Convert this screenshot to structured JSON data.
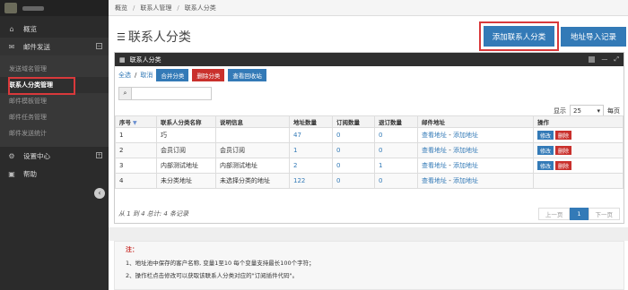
{
  "sidebar": {
    "items": [
      {
        "label": "概览",
        "icon": "home-icon"
      },
      {
        "label": "邮件发送",
        "icon": "mail-icon"
      },
      {
        "label": "设置中心",
        "icon": "gear-icon"
      },
      {
        "label": "帮助",
        "icon": "help-icon"
      }
    ],
    "sub_items": [
      {
        "label": "发送域名管理"
      },
      {
        "label": "联系人分类管理"
      },
      {
        "label": "邮件模板管理"
      },
      {
        "label": "邮件任务管理"
      },
      {
        "label": "邮件发送统计"
      }
    ]
  },
  "breadcrumb": [
    "概览",
    "联系人管理",
    "联系人分类"
  ],
  "page": {
    "title": "联系人分类",
    "add_button": "添加联系人分类",
    "import_button": "地址导入记录"
  },
  "panel": {
    "title": "联系人分类",
    "select_all": "全选",
    "cancel": "取消",
    "merge": "合并分类",
    "delete": "删除分类",
    "recycle": "查看回收站",
    "search_value": "",
    "page_size_label": "显示",
    "page_size_value": "25",
    "page_size_suffix": "每页"
  },
  "table": {
    "headers": [
      "序号",
      "联系人分类名称",
      "说明信息",
      "地址数量",
      "订阅数量",
      "退订数量",
      "邮件地址",
      "操作"
    ],
    "rows": [
      {
        "no": "1",
        "name": "巧",
        "desc": "",
        "addr": "47",
        "sub": "0",
        "unsub": "0",
        "view": "查看地址",
        "add": "添加地址",
        "edit": "修改",
        "del": "删除"
      },
      {
        "no": "2",
        "name": "会员订阅",
        "desc": "会员订阅",
        "addr": "1",
        "sub": "0",
        "unsub": "0",
        "view": "查看地址",
        "add": "添加地址",
        "edit": "修改",
        "del": "删除"
      },
      {
        "no": "3",
        "name": "内部测试地址",
        "desc": "内部测试地址",
        "addr": "2",
        "sub": "0",
        "unsub": "1",
        "view": "查看地址",
        "add": "添加地址",
        "edit": "修改",
        "del": "删除"
      },
      {
        "no": "4",
        "name": "未分类地址",
        "desc": "未选择分类的地址",
        "addr": "122",
        "sub": "0",
        "unsub": "0",
        "view": "查看地址",
        "add": "添加地址",
        "edit": "",
        "del": ""
      }
    ]
  },
  "footer": {
    "summary": "从 1 到 4 总计: 4 条记录",
    "prev": "上一页",
    "page": "1",
    "next": "下一页"
  },
  "notes": {
    "title": "注：",
    "lines": [
      "1、地址池中保存的客户名称, 变量1至10 每个变量支持最长100个字符；",
      "2、操作栏点击修改可以获取该联系人分类对应的\"订阅插件代码\"。"
    ]
  }
}
